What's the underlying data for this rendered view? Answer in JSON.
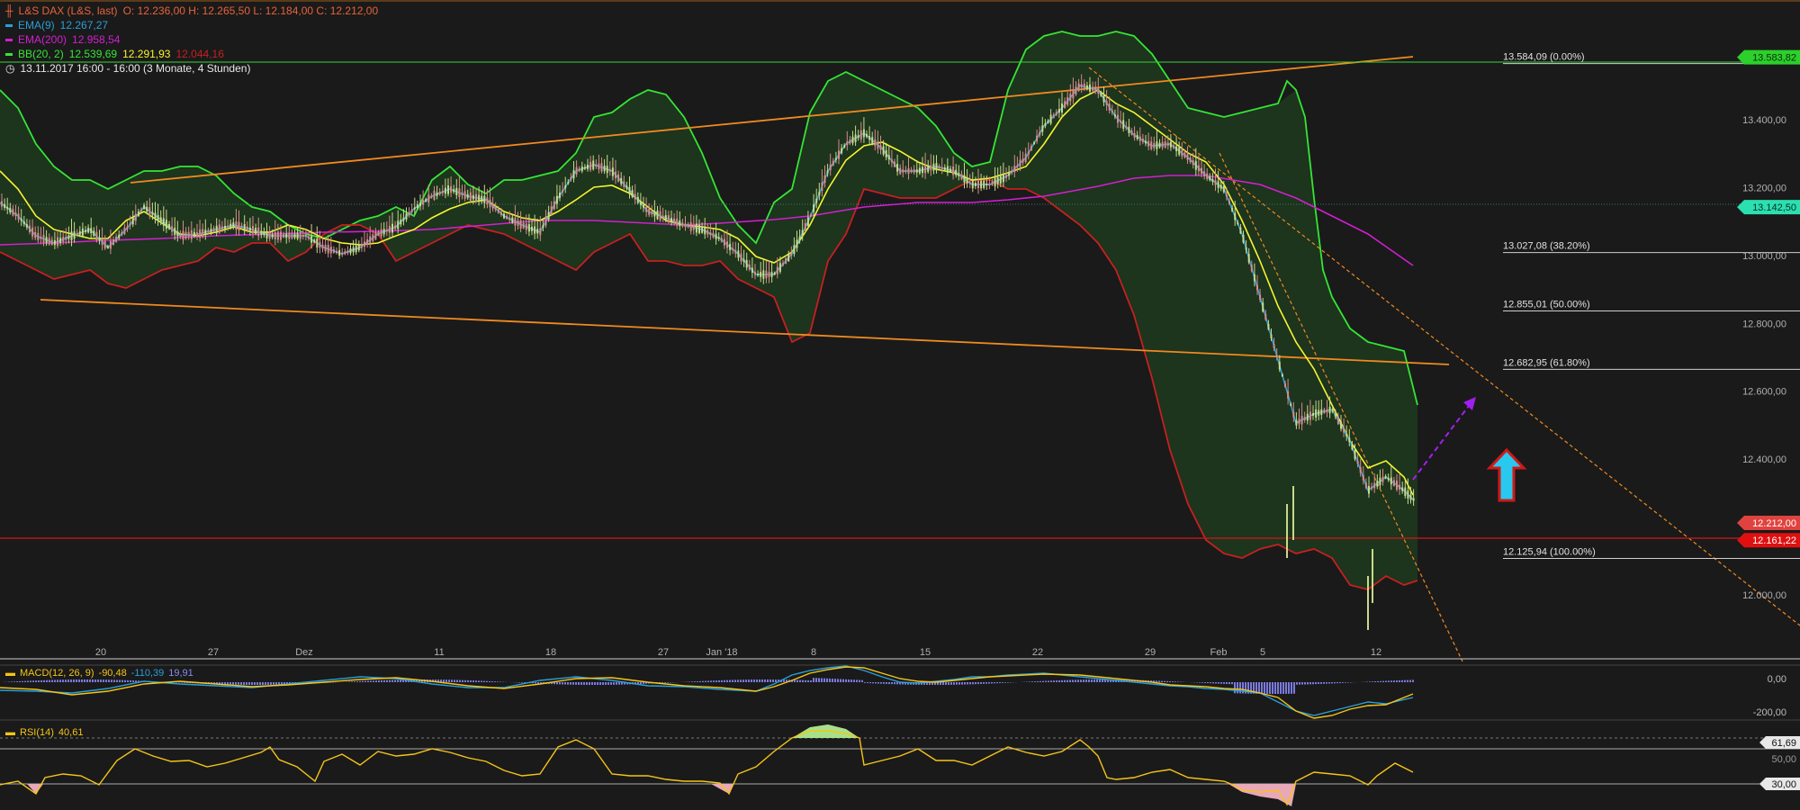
{
  "instrument": {
    "name": "L&S DAX (L&S, last)",
    "ohlc": "O: 12.236,00  H: 12.265,50  L: 12.184,00  C: 12.212,00",
    "ema9_label": "EMA(9)",
    "ema9_value": "12.267,27",
    "ema200_label": "EMA(200)",
    "ema200_value": "12.958,54",
    "bb_label": "BB(20, 2)",
    "bb_upper": "12.539,69",
    "bb_mid": "12.291,93",
    "bb_lower": "12.044,16",
    "period": "13.11.2017 16:00 - 16:00   (3 Monate, 4 Stunden)"
  },
  "macd": {
    "label": "MACD(12, 26, 9)",
    "v1": "-90,48",
    "v2": "-110,39",
    "v3": "19,91"
  },
  "rsi": {
    "label": "RSI(14)",
    "value": "40,61"
  },
  "colors": {
    "background": "#1a1a1a",
    "candle_up": "#c9d98a",
    "candle_down": "#d88a8a",
    "ema9": "#2a9fd8",
    "ema200": "#d21fd2",
    "bb_upper": "#35e535",
    "bb_mid": "#f5f530",
    "bb_lower": "#c62020",
    "bb_fill": "#1e3a1e",
    "trendline": "#f08a20",
    "support_line": "#d01818",
    "fib_line": "#cfcfcf",
    "projection": "#a020f0",
    "arrow_fill": "#29c8ee",
    "arrow_border": "#d01818"
  },
  "chart_data": {
    "type": "candlestick",
    "y_range": [
      11800,
      13900
    ],
    "y_ticks": [
      "13.400,00",
      "13.200,00",
      "13.000,00",
      "12.800,00",
      "12.600,00",
      "12.400,00",
      "12.000,00"
    ],
    "x_ticks": [
      "20",
      "27",
      "Dez",
      "11",
      "18",
      "27",
      "Jan '18",
      "8",
      "15",
      "22",
      "29",
      "Feb",
      "5",
      "12"
    ],
    "price_markers": [
      "13.583,82",
      "13.142,50",
      "12.212,00",
      "12.161,22"
    ],
    "fib_levels": [
      {
        "label": "13.584,09 (0.00%)",
        "value": 13584.09
      },
      {
        "label": "13.027,08 (38.20%)",
        "value": 13027.08
      },
      {
        "label": "12.855,01 (50.00%)",
        "value": 12855.01
      },
      {
        "label": "12.682,95 (61.80%)",
        "value": 12682.95
      },
      {
        "label": "12.125,94 (100.00%)",
        "value": 12125.94
      }
    ],
    "close_path": [
      [
        0,
        13000
      ],
      [
        0.03,
        12980
      ],
      [
        0.045,
        12850
      ],
      [
        0.06,
        12920
      ],
      [
        0.08,
        12970
      ],
      [
        0.09,
        13030
      ],
      [
        0.11,
        13150
      ],
      [
        0.13,
        13070
      ],
      [
        0.15,
        12970
      ],
      [
        0.17,
        12990
      ],
      [
        0.19,
        12970
      ],
      [
        0.21,
        13000
      ],
      [
        0.23,
        13050
      ],
      [
        0.25,
        13080
      ],
      [
        0.27,
        13020
      ],
      [
        0.29,
        12950
      ],
      [
        0.31,
        12950
      ],
      [
        0.33,
        12960
      ],
      [
        0.36,
        12950
      ],
      [
        0.38,
        12960
      ],
      [
        0.41,
        12970
      ],
      [
        0.44,
        12980
      ],
      [
        0.46,
        13050
      ],
      [
        0.47,
        13130
      ],
      [
        0.49,
        13150
      ],
      [
        0.51,
        13130
      ],
      [
        0.53,
        13120
      ],
      [
        0.55,
        13100
      ],
      [
        0.57,
        13090
      ],
      [
        0.59,
        13060
      ],
      [
        0.61,
        13010
      ],
      [
        0.63,
        12980
      ],
      [
        0.64,
        13000
      ],
      [
        0.66,
        13020
      ],
      [
        0.67,
        13060
      ],
      [
        0.68,
        13160
      ],
      [
        0.69,
        13240
      ],
      [
        0.7,
        13320
      ],
      [
        0.72,
        13340
      ],
      [
        0.74,
        13350
      ],
      [
        0.76,
        13320
      ],
      [
        0.77,
        13270
      ],
      [
        0.78,
        13240
      ],
      [
        0.8,
        13230
      ],
      [
        0.82,
        13220
      ],
      [
        0.83,
        13200
      ],
      [
        0.84,
        13230
      ],
      [
        0.85,
        13270
      ],
      [
        0.86,
        13300
      ],
      [
        0.88,
        13290
      ],
      [
        0.9,
        13290
      ],
      [
        0.92,
        13340
      ],
      [
        0.94,
        13360
      ],
      [
        0.96,
        13370
      ],
      [
        0.98,
        13380
      ],
      [
        1,
        13380
      ]
    ],
    "ohlc_sample_note": "",
    "ema9_path_units": "price",
    "rsi_levels": [
      "61,69",
      "50,00",
      "30,00"
    ],
    "macd_ticks": [
      "0,00",
      "-200,00"
    ]
  }
}
